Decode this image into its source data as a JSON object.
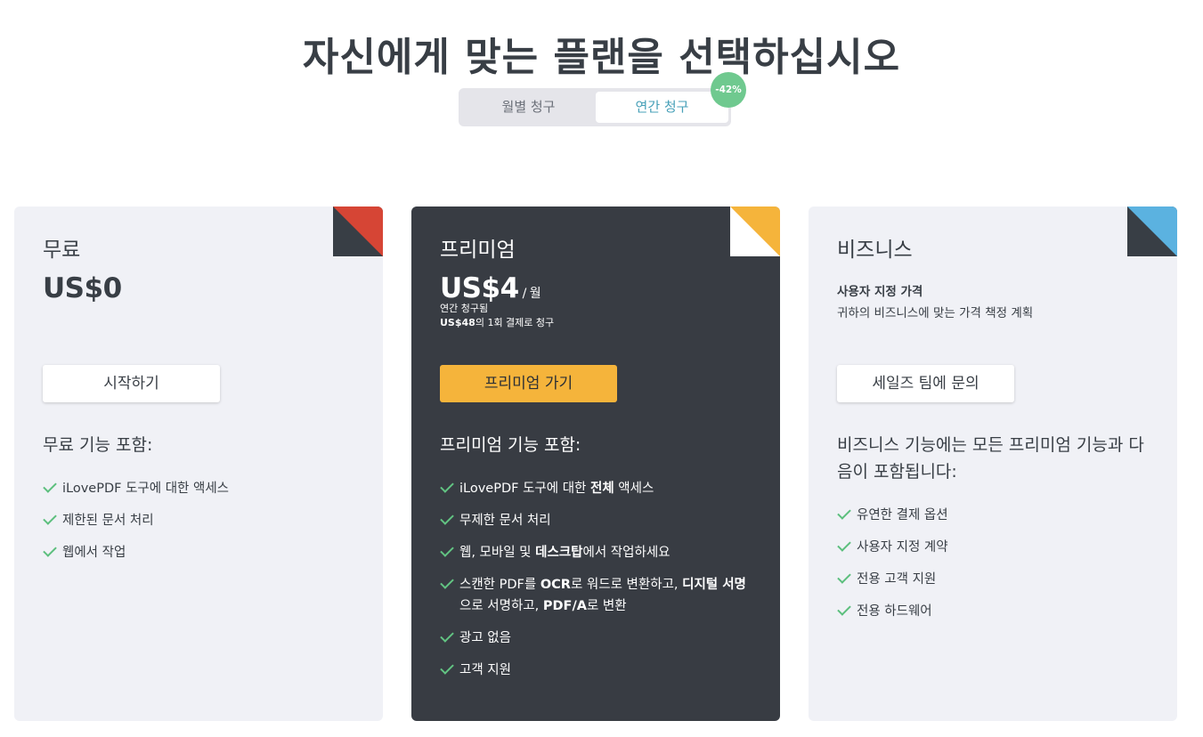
{
  "page_title": "자신에게 맞는 플랜을 선택하십시오",
  "billing_toggle": {
    "monthly_label": "월별 청구",
    "annual_label": "연간 청구",
    "selected": "annual",
    "discount_badge": "-42%"
  },
  "plans": {
    "free": {
      "name": "무료",
      "price": "US$0",
      "corner_color": "#d64535",
      "cta": "시작하기",
      "features_title": "무료 기능 포함:",
      "features": [
        "iLovePDF 도구에 대한 액세스",
        "제한된 문서 처리",
        "웹에서 작업"
      ]
    },
    "premium": {
      "name": "프리미엄",
      "price": "US$4",
      "price_unit": "/ 월",
      "billing_note": "연간 청구됨",
      "billing_total_amount": "US$48",
      "billing_total_suffix": "의 1회 결제로 청구",
      "corner_color": "#f5b43b",
      "cta": "프리미엄 가기",
      "features_title": "프리미엄 기능 포함:",
      "features": [
        {
          "parts": [
            {
              "text": "iLovePDF 도구에 대한 "
            },
            {
              "text": "전체",
              "bold": true
            },
            {
              "text": " 액세스"
            }
          ]
        },
        {
          "parts": [
            {
              "text": "무제한 문서 처리"
            }
          ]
        },
        {
          "parts": [
            {
              "text": "웹, 모바일 및 "
            },
            {
              "text": "데스크탑",
              "bold": true
            },
            {
              "text": "에서 작업하세요"
            }
          ]
        },
        {
          "parts": [
            {
              "text": "스캔한 PDF를 "
            },
            {
              "text": "OCR",
              "bold": true
            },
            {
              "text": "로 워드로 변환하고, "
            },
            {
              "text": "디지털 서명",
              "bold": true
            },
            {
              "text": "으로 서명하고, "
            },
            {
              "text": "PDF/A",
              "bold": true
            },
            {
              "text": "로 변환"
            }
          ]
        },
        {
          "parts": [
            {
              "text": "광고 없음"
            }
          ]
        },
        {
          "parts": [
            {
              "text": "고객 지원"
            }
          ]
        }
      ]
    },
    "business": {
      "name": "비즈니스",
      "subtitle_strong": "사용자 지정 가격",
      "subtitle": "귀하의 비즈니스에 맞는 가격 책정 계획",
      "corner_color": "#5bb2e0",
      "cta": "세일즈 팀에 문의",
      "features_title": "비즈니스 기능에는 모든 프리미엄 기능과 다음이 포함됩니다:",
      "features": [
        "유연한 결제 옵션",
        "사용자 지정 계약",
        "전용 고객 지원",
        "전용 하드웨어"
      ]
    }
  }
}
